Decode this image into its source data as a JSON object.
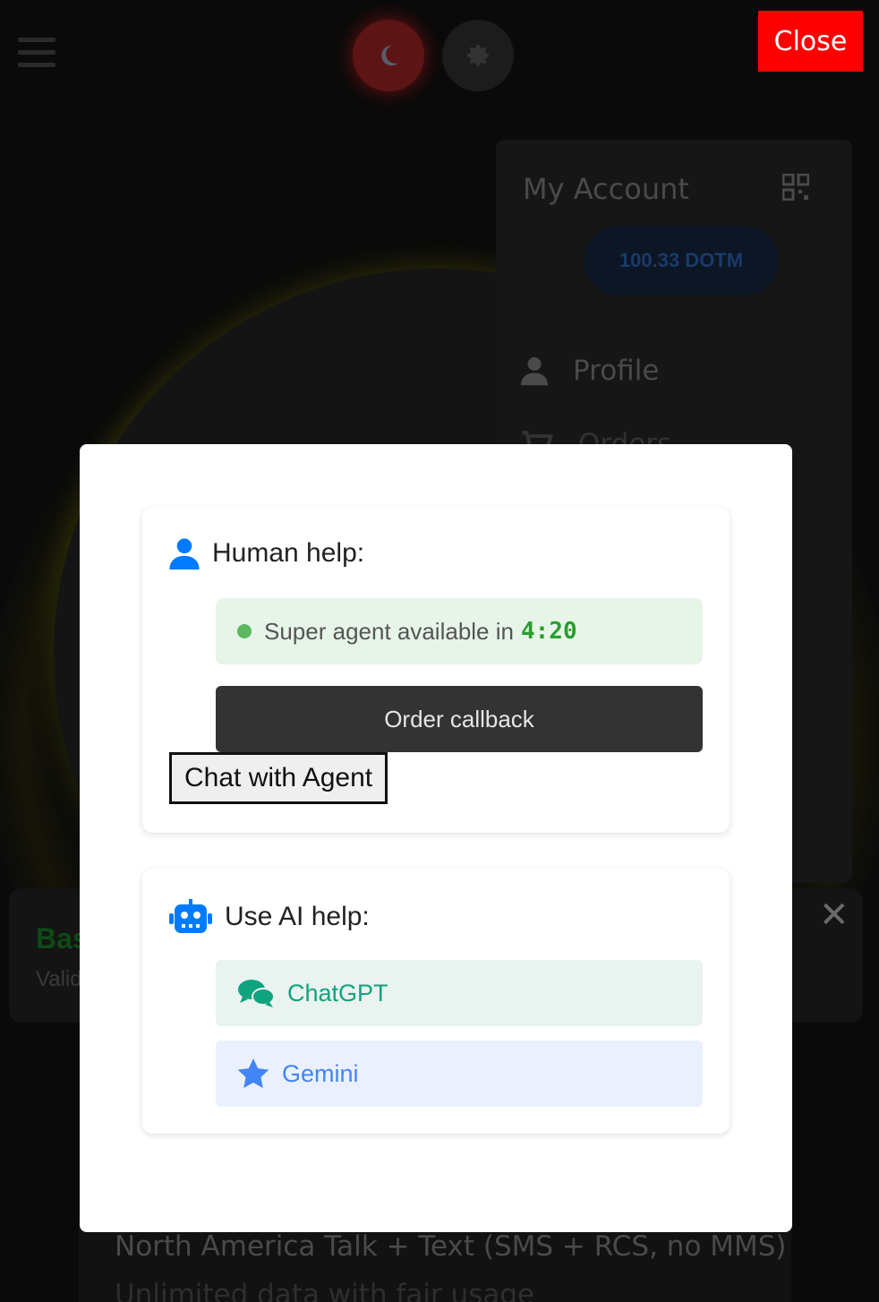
{
  "topbar": {
    "close_label": "Close"
  },
  "account": {
    "title": "My Account",
    "balance": "100.33 DOTM",
    "menu": {
      "profile": "Profile",
      "orders": "Orders"
    }
  },
  "plan": {
    "title": "Basic",
    "subtitle": "Valid",
    "feature_line": "North America Talk + Text (SMS + RCS, no MMS)",
    "feature_line_2": "Unlimited data with fair usage"
  },
  "modal": {
    "human": {
      "heading": "Human help:",
      "status_text": "Super agent available in",
      "timer": "4:20",
      "callback_label": "Order callback",
      "chat_label": "Chat with Agent"
    },
    "ai": {
      "heading": "Use AI help:",
      "chatgpt_label": "ChatGPT",
      "gemini_label": "Gemini"
    }
  },
  "icons": {
    "menu": "hamburger-icon",
    "dark_mode": "moon-icon",
    "light_mode": "gear-icon",
    "qr": "qr-code-icon",
    "profile": "user-icon",
    "orders": "cart-icon",
    "human": "user-icon",
    "ai": "robot-icon",
    "chatgpt": "chat-bubbles-icon",
    "gemini": "star-icon",
    "dismiss": "close-x-icon"
  },
  "colors": {
    "close_button": "#ff0000",
    "accent_blue": "#007bff",
    "status_green": "#2a9d2f",
    "chatgpt": "#10a37f",
    "gemini": "#4285f4"
  }
}
